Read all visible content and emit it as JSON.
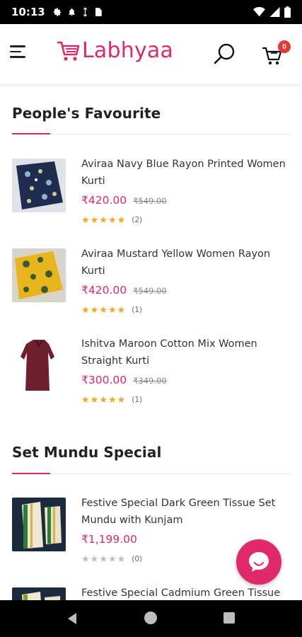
{
  "status_bar": {
    "time": "10:13"
  },
  "header": {
    "brand": "Labhyaa",
    "cart_count": "0",
    "brand_color": "#e1286a"
  },
  "sections": [
    {
      "title": "People's Favourite",
      "products": [
        {
          "name": "Aviraa Navy Blue Rayon Printed Women Kurti",
          "price": "₹420.00",
          "mrp": "₹549.00",
          "stars": 5,
          "review_count": "(2)"
        },
        {
          "name": "Aviraa Mustard Yellow Women Rayon Kurti",
          "price": "₹420.00",
          "mrp": "₹549.00",
          "stars": 5,
          "review_count": "(1)"
        },
        {
          "name": "Ishitva Maroon Cotton Mix Women Straight Kurti",
          "price": "₹300.00",
          "mrp": "₹349.00",
          "stars": 5,
          "review_count": "(1)"
        }
      ]
    },
    {
      "title": "Set Mundu Special",
      "products": [
        {
          "name": "Festive Special Dark Green Tissue Set Mundu with Kunjam",
          "price": "₹1,199.00",
          "mrp": "",
          "stars": 0,
          "review_count": "(0)"
        },
        {
          "name": "Festive Special Cadmium Green Tissue"
        }
      ]
    }
  ],
  "icons": {
    "menu": "hamburger-menu-icon",
    "search": "search-icon",
    "cart": "cart-icon",
    "chat": "chat-bubble-icon"
  }
}
